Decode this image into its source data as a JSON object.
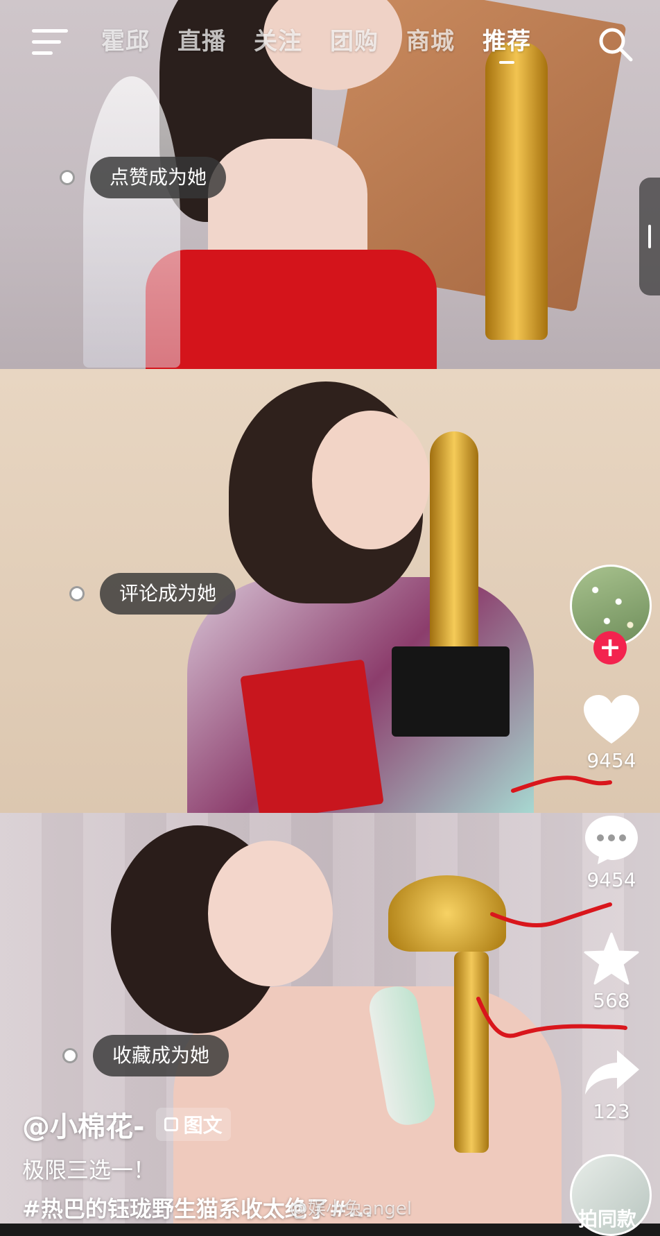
{
  "nav": {
    "tabs": [
      "霍邱",
      "直播",
      "关注",
      "团购",
      "商城",
      "推荐"
    ],
    "active_tab": "推荐"
  },
  "polls": [
    {
      "label": "点赞成为她"
    },
    {
      "label": "评论成为她"
    },
    {
      "label": "收藏成为她"
    }
  ],
  "actions": {
    "like_count": "9454",
    "comment_count": "9454",
    "favorite_count": "568",
    "share_count": "123",
    "follow_symbol": "+"
  },
  "post": {
    "author": "@小棉花-",
    "type_label": "图文",
    "caption": "极限三选一！",
    "hashtag": "#热巴的钰珑野生猫系收太绝了#..."
  },
  "same_style_label": "拍同款",
  "watermark": "@娱小兔angel",
  "colors": {
    "follow_plus": "#f3234e",
    "annotation_red": "#d9161c",
    "pill_bg": "rgba(55,55,55,0.82)"
  },
  "icons": [
    "menu-icon",
    "search-icon",
    "heart-icon",
    "comment-icon",
    "star-icon",
    "share-icon",
    "image-text-icon"
  ]
}
